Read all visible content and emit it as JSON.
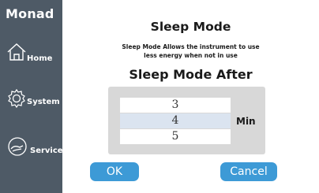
{
  "sidebar": {
    "brand": "Monad",
    "items": [
      {
        "label": "Home",
        "icon": "home-icon"
      },
      {
        "label": "System",
        "icon": "gear-icon"
      },
      {
        "label": "Service",
        "icon": "service-icon"
      }
    ]
  },
  "main": {
    "title": "Sleep Mode",
    "description_line1": "Sleep Mode Allows the  instrument to use",
    "description_line2": "less energy when not in use",
    "subtitle": "Sleep Mode After",
    "picker": {
      "values": [
        "3",
        "4",
        "5"
      ],
      "selected": "4",
      "unit": "Min"
    },
    "ok_label": "OK",
    "cancel_label": "Cancel"
  },
  "colors": {
    "sidebar": "#4e5a66",
    "button": "#3d9ad6",
    "panel": "#d8d8d8",
    "selected_row": "#dbe4f0"
  }
}
